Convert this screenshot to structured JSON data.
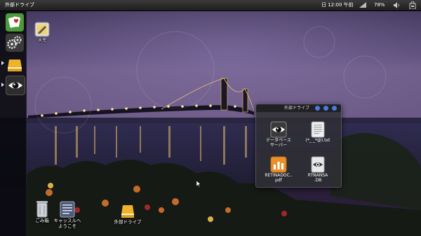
{
  "top_panel": {
    "title": "外部ドライブ",
    "clock": "日 12:00 午前",
    "battery": "78%",
    "icons": [
      "network-icon",
      "speaker-icon",
      "bag-icon"
    ]
  },
  "launcher": {
    "items": [
      {
        "name": "solitaire-app",
        "icon": "cards-icon",
        "running": false
      },
      {
        "name": "system-settings",
        "icon": "gears-icon",
        "running": false
      },
      {
        "name": "external-drive",
        "icon": "drive-icon",
        "running": true
      },
      {
        "name": "eye-app",
        "icon": "eye-icon",
        "running": true
      }
    ]
  },
  "desktop": {
    "memo_label": "メモ",
    "trash_label": "ごみ箱",
    "welcome_label_1": "キャッスルへ",
    "welcome_label_2": "ようこそ",
    "drive_label": "外部ドライブ"
  },
  "folder_window": {
    "title": "外部ドライブ",
    "files": [
      {
        "label_1": "データベース",
        "label_2": "サーバー",
        "icon": "eye-icon"
      },
      {
        "label_1": "(*_ _*@).txt",
        "label_2": "",
        "icon": "text-file-icon"
      },
      {
        "label_1": "RETINADOC..",
        "label_2": "pdf",
        "icon": "pdf-file-icon"
      },
      {
        "label_1": "RTNANSA",
        "label_2": ".DB",
        "icon": "db-file-icon"
      }
    ]
  },
  "colors": {
    "sky_top": "#3e3458",
    "sky_bottom": "#6a5a86",
    "water": "#2c2d4a",
    "bridge_lights": "#ffd98a",
    "accent_blue": "#3f7ad6"
  }
}
